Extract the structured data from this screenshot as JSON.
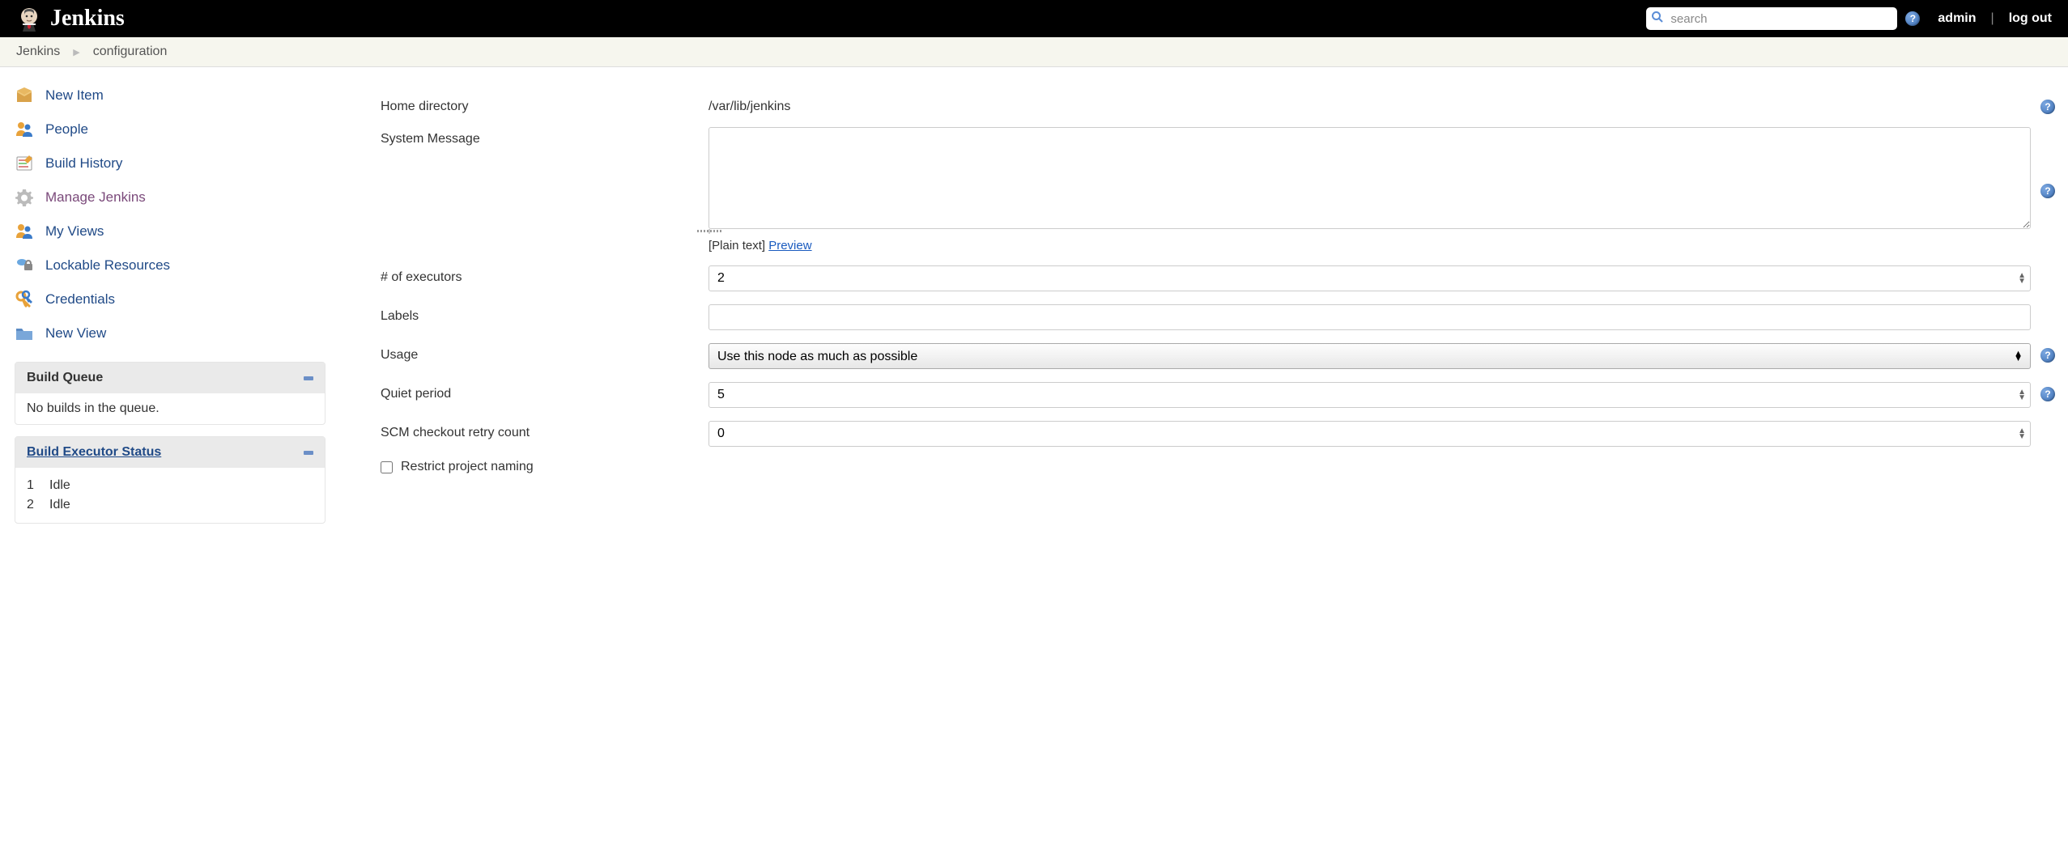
{
  "header": {
    "logo_text": "Jenkins",
    "search_placeholder": "search",
    "user_label": "admin",
    "logout_label": "log out",
    "separator": "|"
  },
  "breadcrumb": {
    "items": [
      "Jenkins",
      "configuration"
    ]
  },
  "sidebar": {
    "tasks": [
      {
        "label": "New Item",
        "icon": "new-item"
      },
      {
        "label": "People",
        "icon": "people"
      },
      {
        "label": "Build History",
        "icon": "build-history"
      },
      {
        "label": "Manage Jenkins",
        "icon": "manage",
        "visited": true
      },
      {
        "label": "My Views",
        "icon": "people"
      },
      {
        "label": "Lockable Resources",
        "icon": "lockable"
      },
      {
        "label": "Credentials",
        "icon": "credentials"
      },
      {
        "label": "New View",
        "icon": "new-view"
      }
    ],
    "build_queue": {
      "title": "Build Queue",
      "empty_text": "No builds in the queue."
    },
    "executor_status": {
      "title": "Build Executor Status",
      "executors": [
        {
          "num": "1",
          "state": "Idle"
        },
        {
          "num": "2",
          "state": "Idle"
        }
      ]
    }
  },
  "config": {
    "home_directory": {
      "label": "Home directory",
      "value": "/var/lib/jenkins"
    },
    "system_message": {
      "label": "System Message",
      "value": "",
      "format_hint": "[Plain text]",
      "preview_label": "Preview"
    },
    "executors": {
      "label": "# of executors",
      "value": "2"
    },
    "labels": {
      "label": "Labels",
      "value": ""
    },
    "usage": {
      "label": "Usage",
      "selected": "Use this node as much as possible"
    },
    "quiet_period": {
      "label": "Quiet period",
      "value": "5"
    },
    "scm_retry": {
      "label": "SCM checkout retry count",
      "value": "0"
    },
    "restrict_naming": {
      "label": "Restrict project naming",
      "checked": false
    }
  }
}
